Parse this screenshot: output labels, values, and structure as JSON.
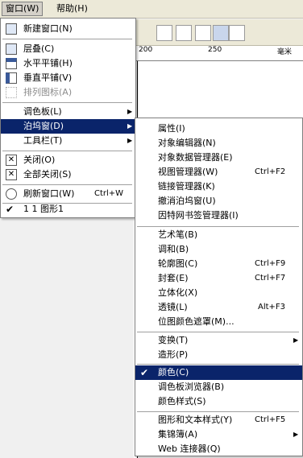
{
  "menubar": {
    "window_label": "窗口(W)",
    "help_label": "帮助(H)"
  },
  "ruler": {
    "ticks": [
      "200",
      "250",
      "毫米"
    ]
  },
  "window_menu": {
    "items": [
      {
        "label": "新建窗口(N)"
      },
      {
        "label": "层叠(C)"
      },
      {
        "label": "水平平铺(H)"
      },
      {
        "label": "垂直平铺(V)"
      },
      {
        "label": "排列图标(A)"
      },
      {
        "label": "调色板(L)"
      },
      {
        "label": "泊坞窗(D)"
      },
      {
        "label": "工具栏(T)"
      },
      {
        "label": "关闭(O)"
      },
      {
        "label": "全部关闭(S)"
      },
      {
        "label": "刷新窗口(W)",
        "shortcut": "Ctrl+W"
      },
      {
        "label": "1 1 图形1"
      }
    ]
  },
  "docker_menu": {
    "items": [
      {
        "label": "属性(I)"
      },
      {
        "label": "对象编辑器(N)"
      },
      {
        "label": "对象数据管理器(E)"
      },
      {
        "label": "视图管理器(W)",
        "shortcut": "Ctrl+F2"
      },
      {
        "label": "链接管理器(K)"
      },
      {
        "label": "撤消泊坞窗(U)"
      },
      {
        "label": "因特网书签管理器(I)"
      },
      {
        "label": "艺术笔(B)"
      },
      {
        "label": "调和(B)"
      },
      {
        "label": "轮廓图(C)",
        "shortcut": "Ctrl+F9"
      },
      {
        "label": "封套(E)",
        "shortcut": "Ctrl+F7"
      },
      {
        "label": "立体化(X)"
      },
      {
        "label": "透镜(L)",
        "shortcut": "Alt+F3"
      },
      {
        "label": "位图颜色遮罩(M)..."
      },
      {
        "label": "变换(T)"
      },
      {
        "label": "造形(P)"
      },
      {
        "label": "颜色(C)"
      },
      {
        "label": "调色板浏览器(B)"
      },
      {
        "label": "颜色样式(S)"
      },
      {
        "label": "图形和文本样式(Y)",
        "shortcut": "Ctrl+F5"
      },
      {
        "label": "集锦簿(A)"
      },
      {
        "label": "Web 连接器(Q)"
      }
    ]
  },
  "colors": {
    "selection": "#0a246a",
    "menu_bg": "#ffffff",
    "disabled": "#8c8c8c"
  }
}
